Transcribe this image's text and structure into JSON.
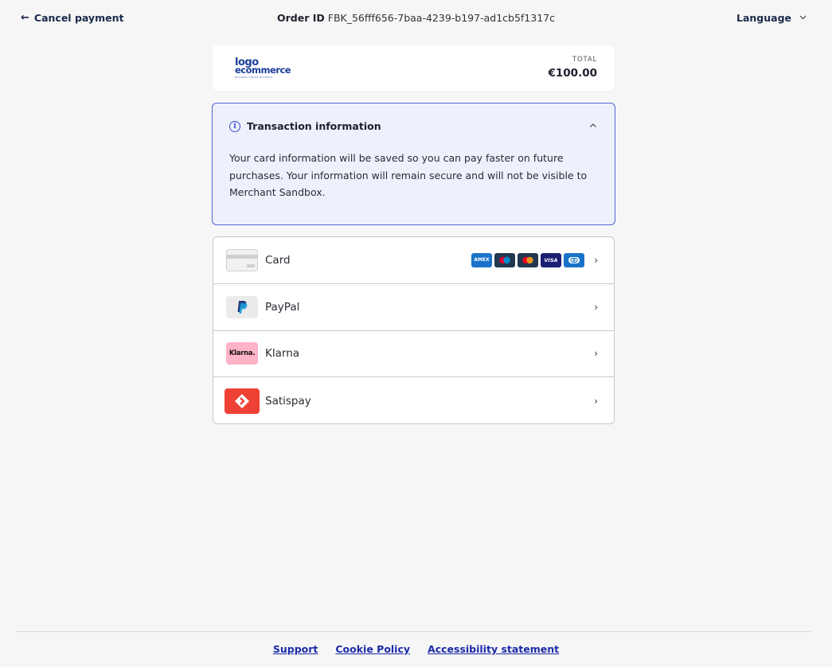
{
  "header": {
    "cancel_label": "Cancel payment",
    "order_label": "Order ID",
    "order_id": "FBK_56fff656-7baa-4239-b197-ad1cb5f1317c",
    "language_label": "Language"
  },
  "summary": {
    "logo_line1": "logo",
    "logo_line2": "ecommerce",
    "logo_tagline": "BUILDING ONLINE BUSINESS",
    "total_label": "TOTAL",
    "total_value": "€100.00"
  },
  "info": {
    "title": "Transaction information",
    "text": "Your card information will be saved so you can pay faster on future purchases. Your information will remain secure and will not be visible to Merchant Sandbox."
  },
  "methods": [
    {
      "label": "Card",
      "icon": "credit-card-icon"
    },
    {
      "label": "PayPal",
      "icon": "paypal-icon"
    },
    {
      "label": "Klarna",
      "icon": "klarna-icon",
      "icon_text": "Klarna."
    },
    {
      "label": "Satispay",
      "icon": "satispay-icon"
    }
  ],
  "card_brands": [
    {
      "name": "amex",
      "text": "AMEX",
      "color": "#1a73c9"
    },
    {
      "name": "maestro",
      "color": "#22384f"
    },
    {
      "name": "mastercard",
      "color": "#22384f"
    },
    {
      "name": "visa",
      "text": "VISA",
      "color": "#1a1f71"
    },
    {
      "name": "diners",
      "color": "#1a73c9"
    }
  ],
  "footer": {
    "links": [
      "Support",
      "Cookie Policy",
      "Accessibility statement"
    ]
  },
  "colors": {
    "accent": "#3a4fd0",
    "info_bg": "#eef0fb",
    "klarna_pink": "#ffb3c7",
    "satispay_red": "#ef4136"
  }
}
